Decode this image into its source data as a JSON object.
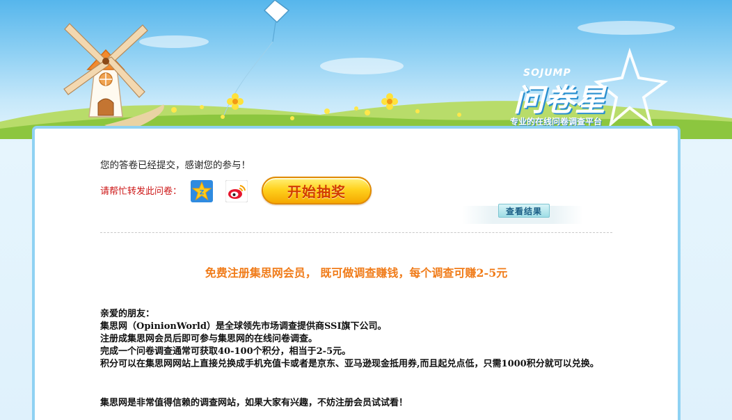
{
  "header": {
    "brand_en": "SOJUMP",
    "brand_cn": "问卷星",
    "slogan": "专业的在线问卷调查平台"
  },
  "thanks_message": "您的答卷已经提交，感谢您的参与！",
  "share": {
    "label": "请帮忙转发此问卷：",
    "icons": [
      "qzone-icon",
      "weibo-icon"
    ]
  },
  "lottery_button": "开始抽奖",
  "view_results_button": "查看结果",
  "promo": {
    "title": "免费注册集思网会员， 既可做调查赚钱，每个调查可赚2-5元",
    "lines": [
      "亲爱的朋友：",
      "集思网（OpinionWorld）是全球领先市场调查提供商SSI旗下公司。",
      "注册成集思网会员后即可参与集思网的在线问卷调查。",
      "完成一个问卷调查通常可获取40-100个积分，相当于2-5元。",
      "积分可以在集思网网站上直接兑换成手机充值卡或者是京东、亚马逊现金抵用券,而且起兑点低，只需1000积分就可以兑换。"
    ],
    "closing": "集思网是非常值得信赖的调查网站，如果大家有兴趣，不妨注册会员试试看！"
  },
  "colors": {
    "sky": "#56b6ec",
    "grass": "#8cc63f",
    "panel_border": "#8fd2f3",
    "share_label": "#cc1414",
    "promo_title": "#f07c1a",
    "lottery_button": "#ffd21e"
  }
}
